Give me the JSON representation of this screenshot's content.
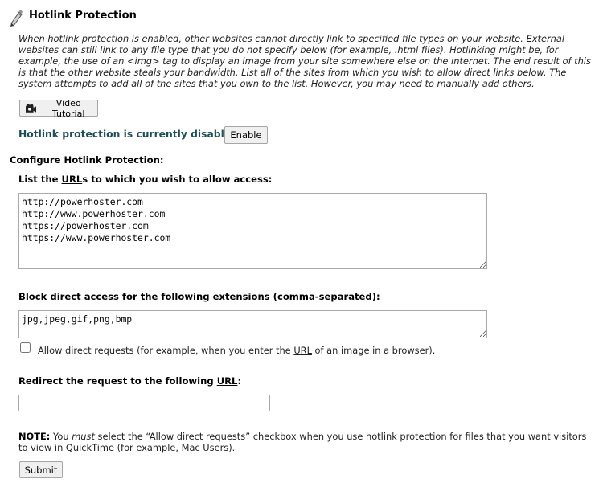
{
  "header": {
    "title": "Hotlink Protection",
    "icon": "pen-icon"
  },
  "description": "When hotlink protection is enabled, other websites cannot directly link to specified file types on your website. External websites can still link to any file type that you do not specify below (for example, .html files). Hotlinking might be, for example, the use of an <img> tag to display an image from your site somewhere else on the internet. The end result of this is that the other website steals your bandwidth. List all of the sites from which you wish to allow direct links below. The system attempts to add all of the sites that you own to the list. However, you may need to manually add others.",
  "video_tutorial": {
    "label": "Video Tutorial",
    "icon": "video-camera-icon"
  },
  "status": {
    "text": "Hotlink protection is currently disabled.",
    "color": "#1c4e58",
    "enable_label": "Enable"
  },
  "configure": {
    "heading": "Configure Hotlink Protection:",
    "urls_label_prefix": "List the ",
    "urls_label_u": "URL",
    "urls_label_suffix": "s to which you wish to allow access:",
    "urls_value": "http://powerhoster.com\nhttp://www.powerhoster.com\nhttps://powerhoster.com\nhttps://www.powerhoster.com",
    "block_label": "Block direct access for the following extensions (comma-separated):",
    "extensions_value": "jpg,jpeg,gif,png,bmp",
    "allow_direct": {
      "checked": false,
      "label_prefix": "Allow direct requests (for example, when you enter the ",
      "label_u": "URL",
      "label_suffix": " of an image in a browser)."
    },
    "redirect_label_prefix": "Redirect the request to the following ",
    "redirect_label_u": "URL",
    "redirect_label_suffix": ":",
    "redirect_value": ""
  },
  "note": {
    "bold": "NOTE:",
    "part1": " You ",
    "italic": "must",
    "part2": " select the “Allow direct requests” checkbox when you use hotlink protection for files that you want visitors to view in QuickTime (for example, Mac Users)."
  },
  "submit_label": "Submit"
}
